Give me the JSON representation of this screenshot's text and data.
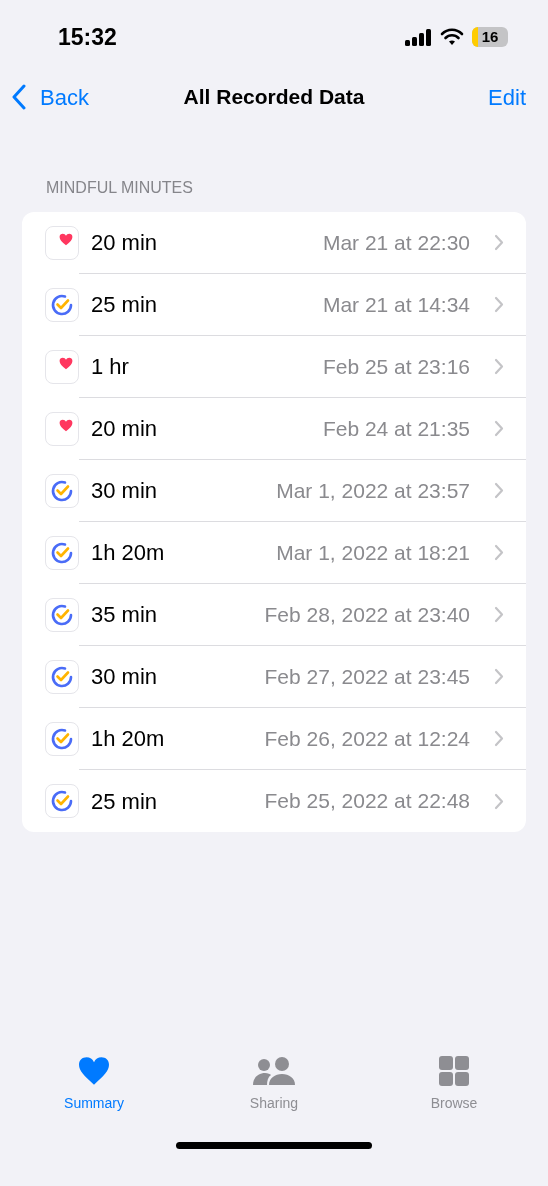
{
  "status_bar": {
    "time": "15:32",
    "battery": "16"
  },
  "nav": {
    "back": "Back",
    "title": "All Recorded Data",
    "action": "Edit"
  },
  "section": {
    "header": "MINDFUL MINUTES",
    "rows": [
      {
        "kind": "health",
        "duration": "20 min",
        "date": "Mar 21 at 22:30"
      },
      {
        "kind": "app",
        "duration": "25 min",
        "date": "Mar 21 at 14:34"
      },
      {
        "kind": "health",
        "duration": "1 hr",
        "date": "Feb 25 at 23:16"
      },
      {
        "kind": "health",
        "duration": "20 min",
        "date": "Feb 24 at 21:35"
      },
      {
        "kind": "app",
        "duration": "30 min",
        "date": "Mar 1, 2022 at 23:57"
      },
      {
        "kind": "app",
        "duration": "1h 20m",
        "date": "Mar 1, 2022 at 18:21"
      },
      {
        "kind": "app",
        "duration": "35 min",
        "date": "Feb 28, 2022 at 23:40"
      },
      {
        "kind": "app",
        "duration": "30 min",
        "date": "Feb 27, 2022 at 23:45"
      },
      {
        "kind": "app",
        "duration": "1h 20m",
        "date": "Feb 26, 2022 at 12:24"
      },
      {
        "kind": "app",
        "duration": "25 min",
        "date": "Feb 25, 2022 at 22:48"
      }
    ]
  },
  "tab_bar": [
    {
      "kind": "heart",
      "label": "Summary",
      "selected": true
    },
    {
      "kind": "people",
      "label": "Sharing",
      "selected": false
    },
    {
      "kind": "grid",
      "label": "Browse",
      "selected": false
    }
  ]
}
